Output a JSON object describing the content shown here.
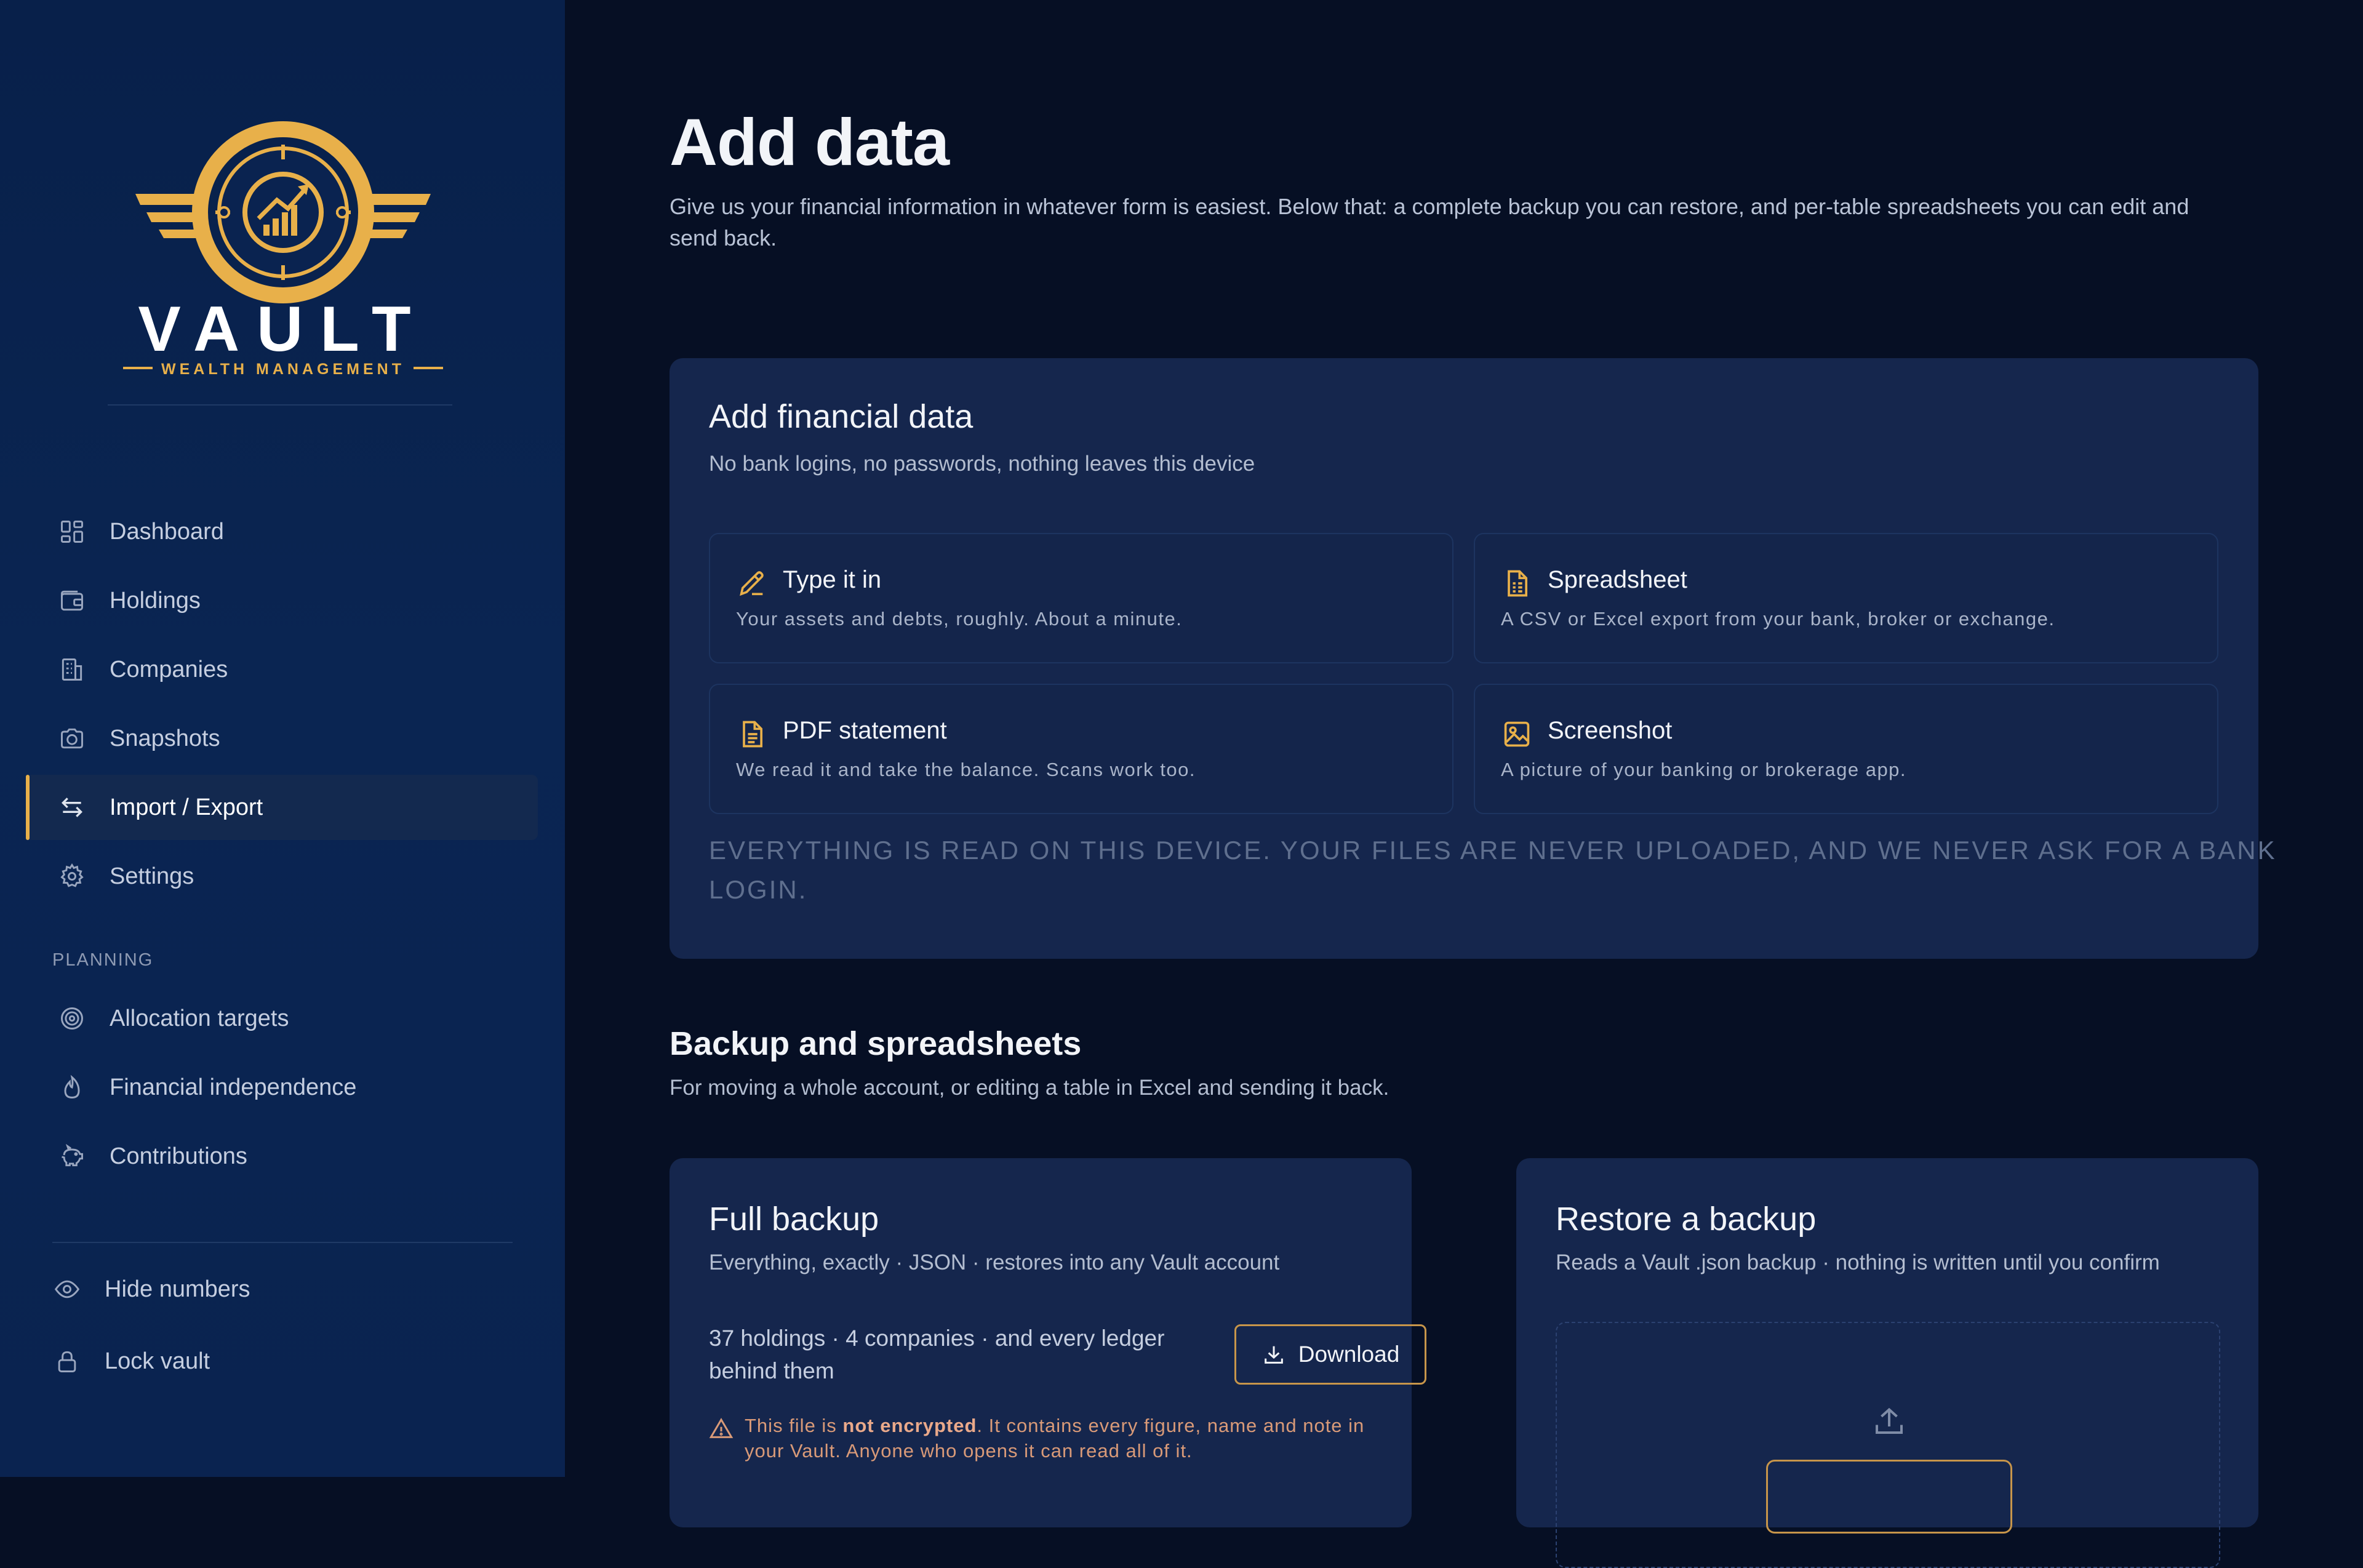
{
  "brand": {
    "name": "VAULT",
    "tagline": "WEALTH MANAGEMENT",
    "accent": "#e8b04a"
  },
  "nav": {
    "primary": [
      {
        "label": "Dashboard",
        "icon": "dashboard-icon"
      },
      {
        "label": "Holdings",
        "icon": "wallet-icon"
      },
      {
        "label": "Companies",
        "icon": "building-icon"
      },
      {
        "label": "Snapshots",
        "icon": "camera-icon"
      },
      {
        "label": "Import / Export",
        "icon": "arrows-exchange-icon",
        "active": true
      },
      {
        "label": "Settings",
        "icon": "gear-icon"
      }
    ],
    "planning_label": "PLANNING",
    "planning": [
      {
        "label": "Allocation targets",
        "icon": "target-icon"
      },
      {
        "label": "Financial independence",
        "icon": "flame-icon"
      },
      {
        "label": "Contributions",
        "icon": "piggy-bank-icon"
      }
    ],
    "footer": [
      {
        "label": "Hide numbers",
        "icon": "eye-icon"
      },
      {
        "label": "Lock vault",
        "icon": "lock-icon"
      }
    ]
  },
  "page": {
    "title": "Add data",
    "description": "Give us your financial information in whatever form is easiest. Below that: a complete backup you can restore, and per-table spreadsheets you can edit and send back."
  },
  "add_card": {
    "title": "Add financial data",
    "subtitle": "No bank logins, no passwords, nothing leaves this device",
    "options": [
      {
        "title": "Type it in",
        "desc": "Your assets and debts, roughly. About a minute.",
        "icon": "pencil-icon"
      },
      {
        "title": "Spreadsheet",
        "desc": "A CSV or Excel export from your bank, broker or exchange.",
        "icon": "spreadsheet-file-icon"
      },
      {
        "title": "PDF statement",
        "desc": "We read it and take the balance. Scans work too.",
        "icon": "document-icon"
      },
      {
        "title": "Screenshot",
        "desc": "A picture of your banking or brokerage app.",
        "icon": "image-icon"
      }
    ],
    "footnote": "Everything is read on this device. Your files are never uploaded, and we never ask for a bank login."
  },
  "backup_section": {
    "title": "Backup and spreadsheets",
    "subtitle": "For moving a whole account, or editing a table in Excel and sending it back."
  },
  "full_backup": {
    "title": "Full backup",
    "subtitle": "Everything, exactly · JSON · restores into any Vault account",
    "stats": "37 holdings · 4 companies · and every ledger behind them",
    "download_label": "Download",
    "warning_prefix": "This file is ",
    "warning_bold": "not encrypted",
    "warning_suffix": ". It contains every figure, name and note in your Vault. Anyone who opens it can read all of it."
  },
  "restore": {
    "title": "Restore a backup",
    "subtitle": "Reads a Vault .json backup · nothing is written until you confirm"
  }
}
